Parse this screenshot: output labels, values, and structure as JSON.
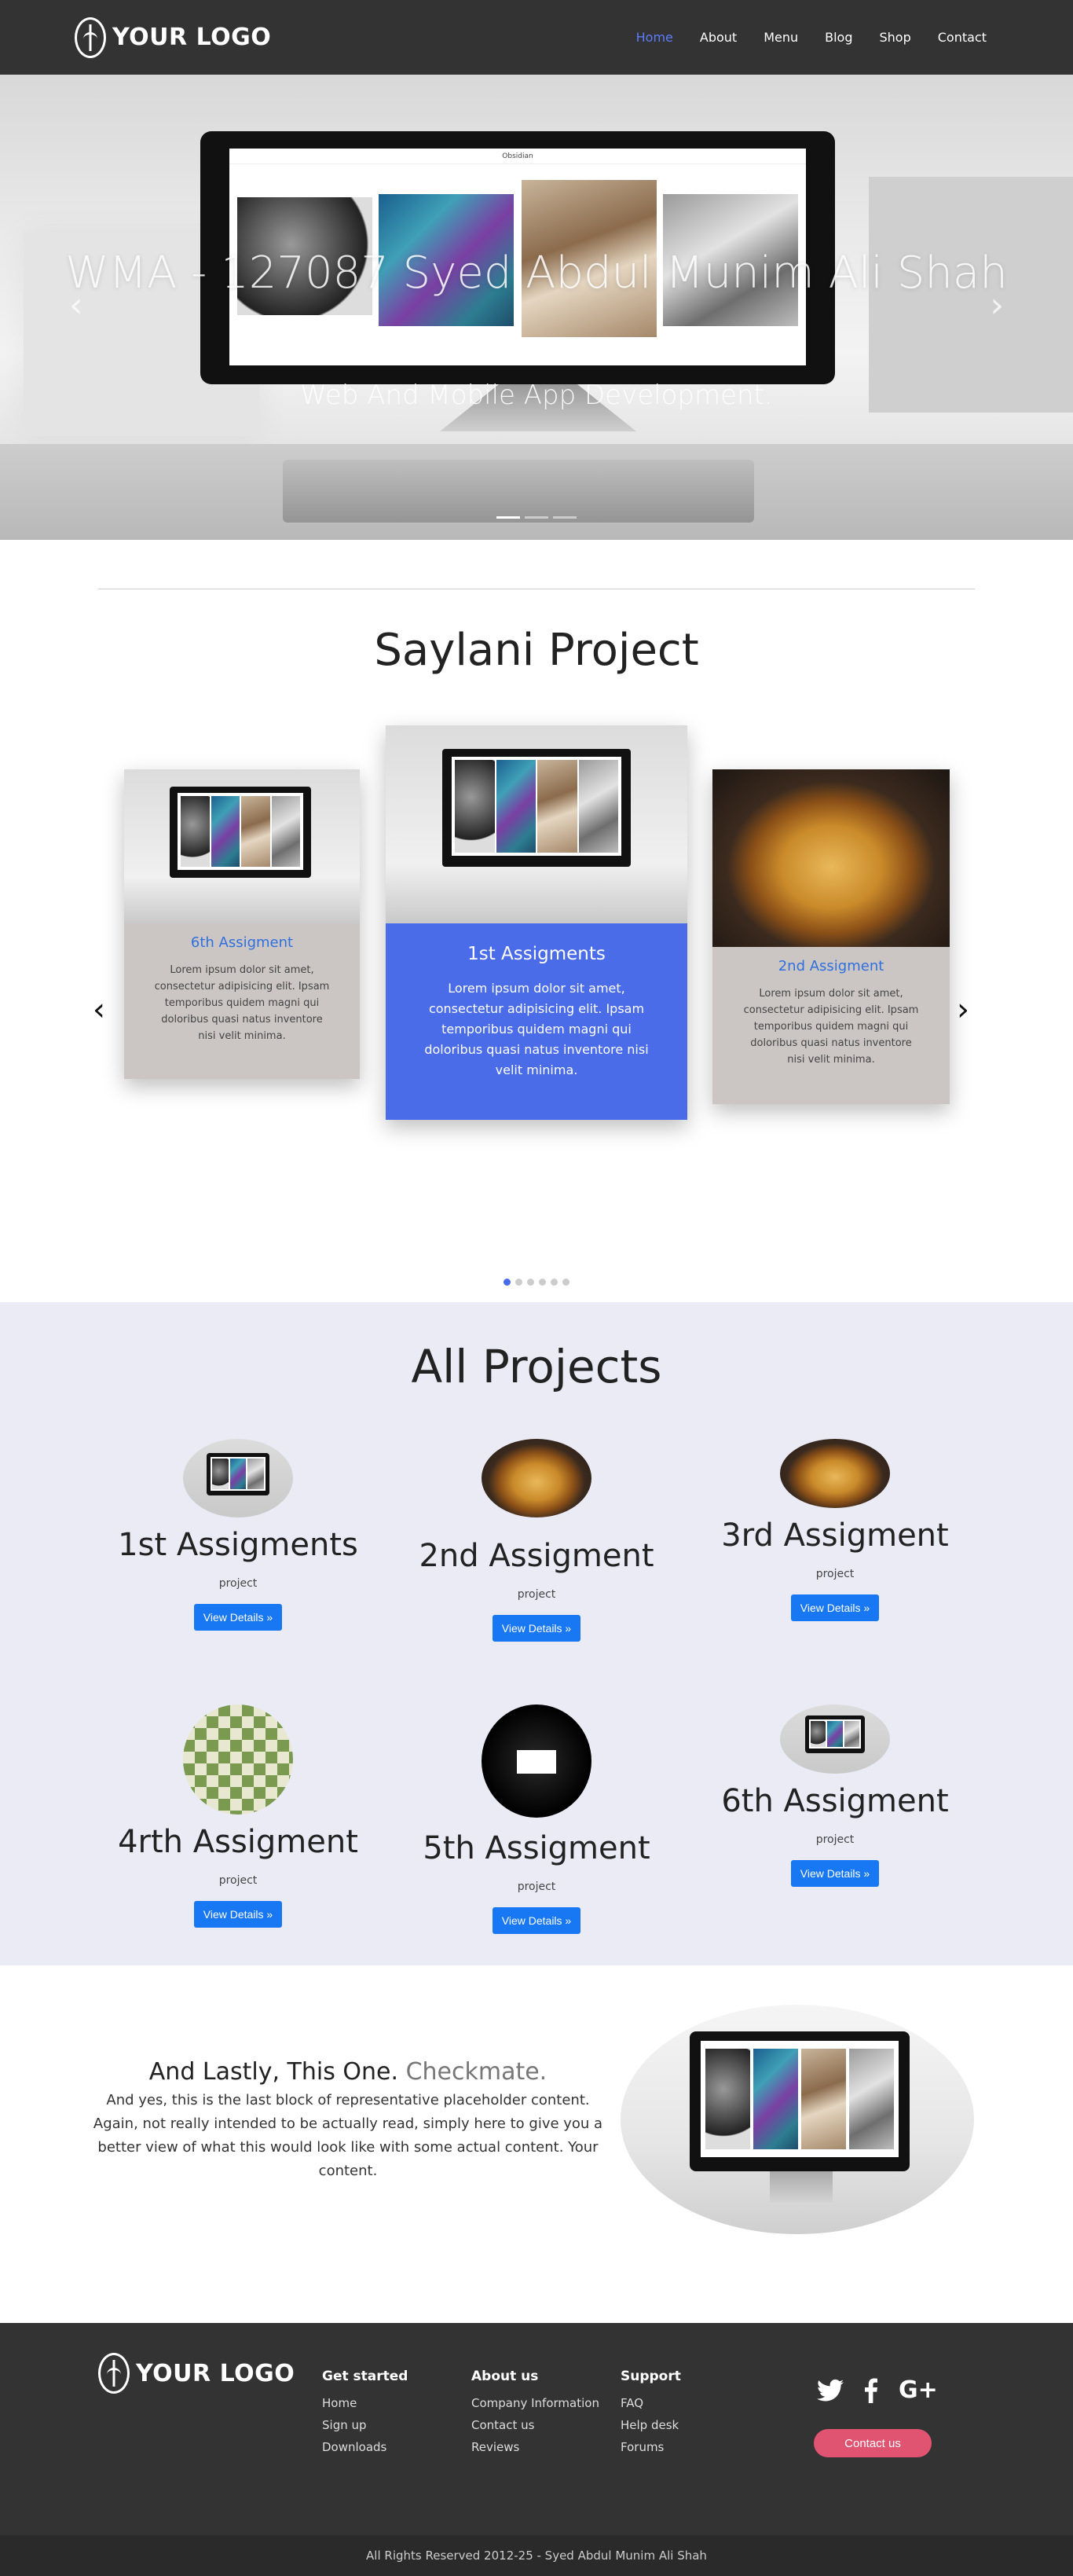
{
  "nav": {
    "logo_text": "YOUR LOGO",
    "links": [
      "Home",
      "About",
      "Menu",
      "Blog",
      "Shop",
      "Contact"
    ],
    "active_link": "Home",
    "active_color": "#5c7cfa"
  },
  "hero": {
    "screen_brand": "Obsidian",
    "title": "WMA - 127087 Syed Abdul Munim Ali Shah",
    "subtitle": "Web And Mobile App Development.",
    "slides_total": 3,
    "active_slide": 1
  },
  "saylani": {
    "title": "Saylani Project",
    "cards": [
      {
        "title": "6th Assigment",
        "text": "Lorem ipsum dolor sit amet, consectetur adipisicing elit. Ipsam temporibus quidem magni qui doloribus quasi natus inventore nisi velit minima."
      },
      {
        "title": "1st Assigments",
        "text": "Lorem ipsum dolor sit amet, consectetur adipisicing elit. Ipsam temporibus quidem magni qui doloribus quasi natus inventore nisi velit minima."
      },
      {
        "title": "2nd Assigment",
        "text": "Lorem ipsum dolor sit amet, consectetur adipisicing elit. Ipsam temporibus quidem magni qui doloribus quasi natus inventore nisi velit minima."
      }
    ],
    "dots_total": 6,
    "active_dot": 1,
    "accent_color": "#4a6ce8"
  },
  "projects": {
    "title": "All Projects",
    "items": [
      {
        "title": "1st Assigments",
        "sub": "project",
        "button": "View Details »"
      },
      {
        "title": "2nd Assigment",
        "sub": "project",
        "button": "View Details »"
      },
      {
        "title": "3rd Assigment",
        "sub": "project",
        "button": "View Details »"
      },
      {
        "title": "4rth Assigment",
        "sub": "project",
        "button": "View Details »"
      },
      {
        "title": "5th Assigment",
        "sub": "project",
        "button": "View Details »"
      },
      {
        "title": "6th Assigment",
        "sub": "project",
        "button": "View Details »"
      }
    ],
    "button_color": "#1877f2"
  },
  "feature": {
    "heading_main": "And Lastly, This One.",
    "heading_muted": "Checkmate.",
    "text": "And yes, this is the last block of representative placeholder content. Again, not really intended to be actually read, simply here to give you a better view of what this would look like with some actual content. Your content."
  },
  "footer": {
    "logo_text": "YOUR LOGO",
    "columns": [
      {
        "heading": "Get started",
        "links": [
          "Home",
          "Sign up",
          "Downloads"
        ]
      },
      {
        "heading": "About us",
        "links": [
          "Company Information",
          "Contact us",
          "Reviews"
        ]
      },
      {
        "heading": "Support",
        "links": [
          "FAQ",
          "Help desk",
          "Forums"
        ]
      }
    ],
    "social_icons": [
      "twitter-icon",
      "facebook-icon",
      "google-plus-icon"
    ],
    "contact_button": "Contact us",
    "contact_color": "#e05472",
    "copyright": "All Rights Reserved 2012-25 - Syed Abdul Munim Ali Shah"
  }
}
